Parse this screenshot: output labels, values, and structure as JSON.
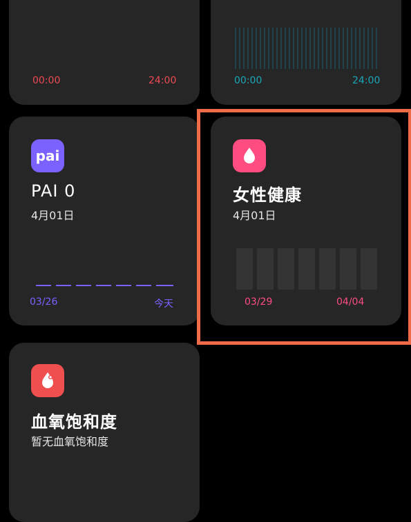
{
  "cards": {
    "top_left": {
      "start": "00:00",
      "end": "24:00",
      "color": "#ef4a55"
    },
    "top_right": {
      "start": "00:00",
      "end": "24:00",
      "color": "#1aa7b8"
    },
    "pai": {
      "icon_text": "pai",
      "title": "PAI 0",
      "date": "4月01日",
      "start": "03/26",
      "end": "今天",
      "accent": "#7b62ff"
    },
    "women_health": {
      "title": "女性健康",
      "date": "4月01日",
      "start": "03/29",
      "end": "04/04",
      "accent": "#ff4d82",
      "icon": "drop-icon"
    },
    "spo2": {
      "title": "血氧饱和度",
      "subtitle": "暂无血氧饱和度",
      "accent": "#f04f4f",
      "icon": "oxygen-drop-icon"
    }
  }
}
